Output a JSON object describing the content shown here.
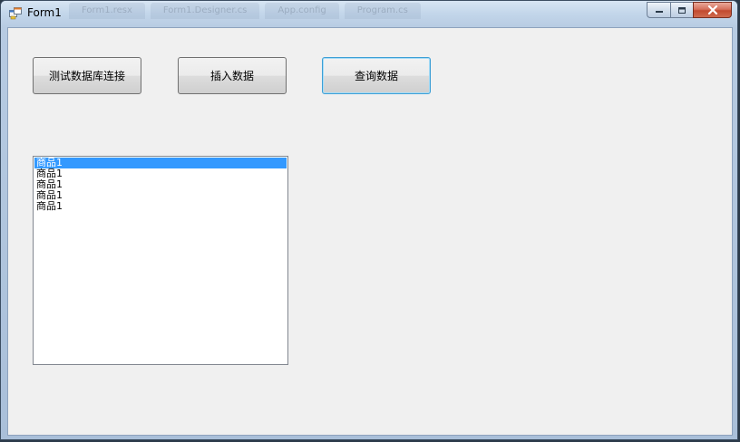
{
  "window": {
    "title": "Form1",
    "ghost_tabs": [
      "Form1.resx",
      "Form1.Designer.cs",
      "App.config",
      "Program.cs"
    ]
  },
  "buttons": {
    "test_connection": "测试数据库连接",
    "insert_data": "插入数据",
    "query_data": "查询数据"
  },
  "listbox": {
    "items": [
      "商品1",
      "商品1",
      "商品1",
      "商品1",
      "商品1"
    ],
    "selected_index": 0
  },
  "colors": {
    "selection": "#3399ff",
    "client_background": "#f0f0f0",
    "focus_border": "#3c9fd6",
    "close_button": "#c24a2f"
  }
}
